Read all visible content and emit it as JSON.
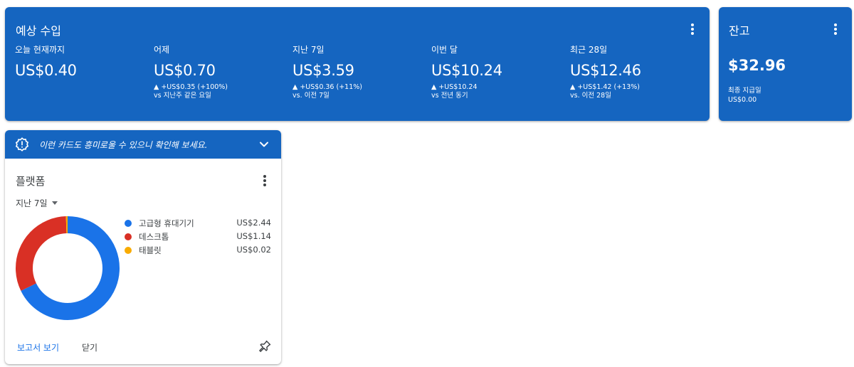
{
  "earnings": {
    "title": "예상 수입",
    "metrics": [
      {
        "label": "오늘 현재까지",
        "value": "US$0.40",
        "change": "",
        "vs": ""
      },
      {
        "label": "어제",
        "value": "US$0.70",
        "change": "▲ +US$0.35 (+100%)",
        "vs": "vs 지난주 같은 요일"
      },
      {
        "label": "지난 7일",
        "value": "US$3.59",
        "change": "▲ +US$0.36 (+11%)",
        "vs": "vs. 이전 7일"
      },
      {
        "label": "이번 달",
        "value": "US$10.24",
        "change": "▲ +US$10.24",
        "vs": "vs 전년 동기"
      },
      {
        "label": "최근 28일",
        "value": "US$12.46",
        "change": "▲ +US$1.42 (+13%)",
        "vs": "vs. 이전 28일"
      }
    ]
  },
  "balance": {
    "title": "잔고",
    "value": "$32.96",
    "last_payment_label": "최종 지급일",
    "last_payment_amount": "US$0.00"
  },
  "platform_card": {
    "banner_text": "이런 카드도 흥미로울 수 있으니 확인해 보세요.",
    "title": "플랫폼",
    "range_label": "지난 7일",
    "legend": [
      {
        "label": "고급형 휴대기기",
        "value": "US$2.44",
        "color": "#1a73e8"
      },
      {
        "label": "데스크톱",
        "value": "US$1.14",
        "color": "#d93025"
      },
      {
        "label": "태블릿",
        "value": "US$0.02",
        "color": "#f9ab00"
      }
    ],
    "view_report_label": "보고서 보기",
    "close_label": "닫기"
  },
  "colors": {
    "card_blue": "#1565c0",
    "link_blue": "#1a73e8"
  }
}
